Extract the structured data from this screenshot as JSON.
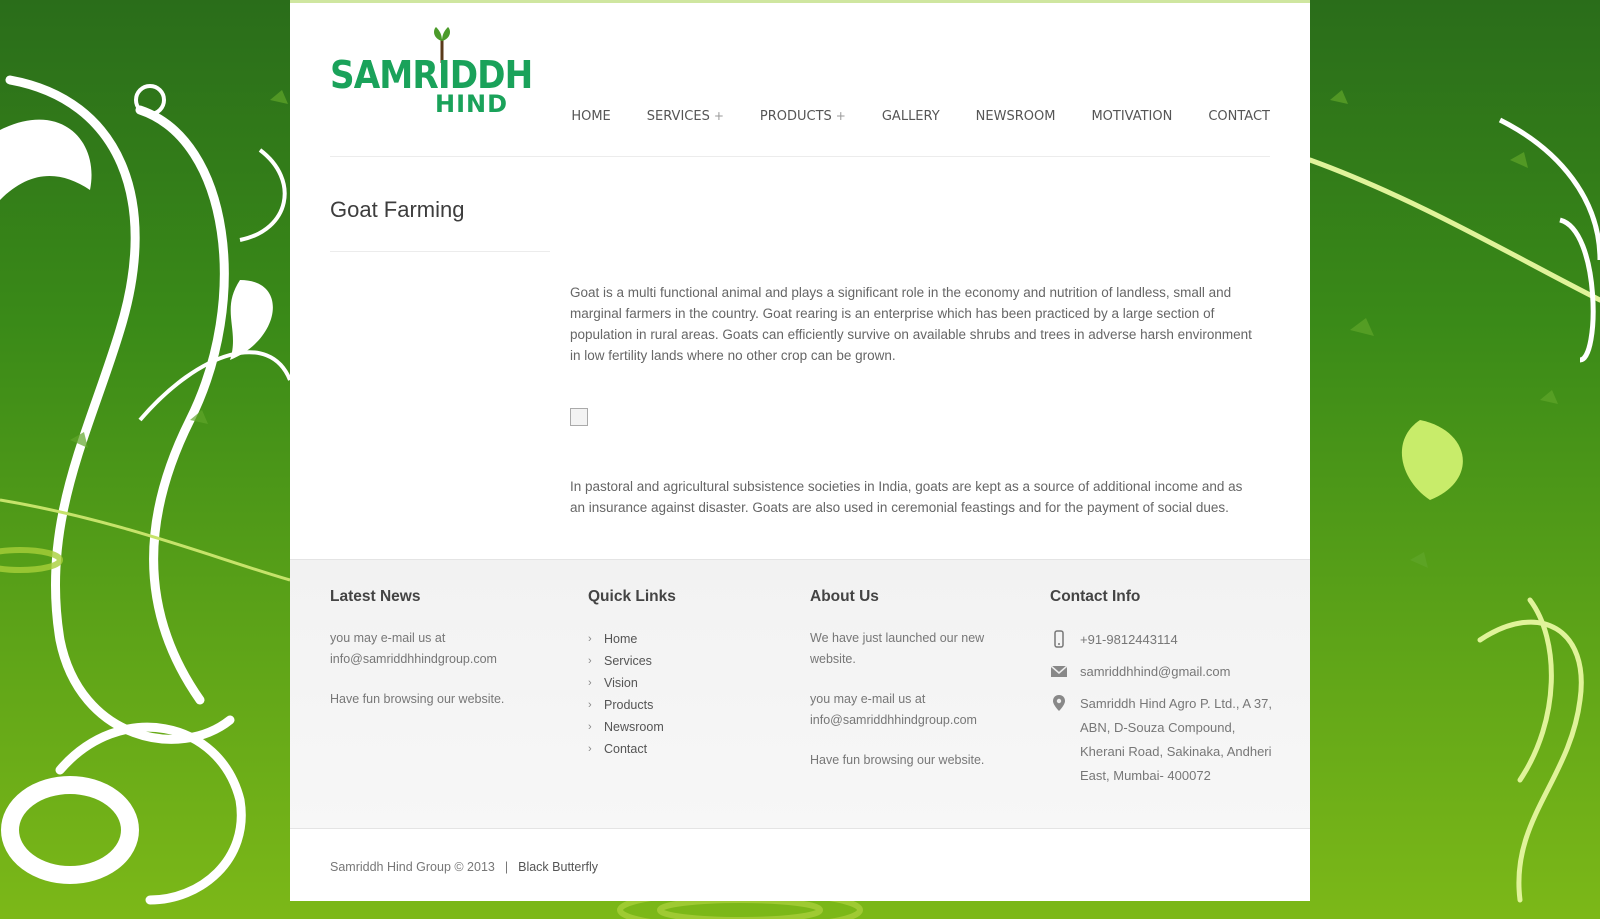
{
  "logo": {
    "line1": "SAMRIDDH",
    "line2": "HIND"
  },
  "nav": {
    "items": [
      {
        "label": "HOME",
        "has_sub": false
      },
      {
        "label": "SERVICES",
        "has_sub": true
      },
      {
        "label": "PRODUCTS",
        "has_sub": true
      },
      {
        "label": "GALLERY",
        "has_sub": false
      },
      {
        "label": "NEWSROOM",
        "has_sub": false
      },
      {
        "label": "MOTIVATION",
        "has_sub": false
      },
      {
        "label": "CONTACT",
        "has_sub": false
      }
    ],
    "sub_marker": "+"
  },
  "page": {
    "title": "Goat Farming",
    "para1": "Goat is a multi functional animal and plays a significant role in the economy and nutrition of landless, small and marginal farmers in the country. Goat rearing is an enterprise which has been practiced by a large section of population in rural areas. Goats can efficiently survive on available shrubs and trees in adverse harsh environment in low fertility lands where no other crop can be grown.",
    "para2": "In pastoral and agricultural subsistence societies in India, goats are kept as a source of additional income and as an insurance against disaster. Goats are also used in ceremonial feastings and for the payment of social dues."
  },
  "footer": {
    "latest_news": {
      "heading": "Latest News",
      "line1": "you may e-mail us at",
      "line2": "info@samriddhhindgroup.com",
      "line3": "Have fun browsing our website."
    },
    "quick_links": {
      "heading": "Quick Links",
      "items": [
        "Home",
        "Services",
        "Vision",
        "Products",
        "Newsroom",
        "Contact"
      ]
    },
    "about": {
      "heading": "About Us",
      "line1": "We have just launched our new website.",
      "line2": "you may e-mail us at info@samriddhhindgroup.com",
      "line3": "Have fun browsing our website."
    },
    "contact": {
      "heading": "Contact Info",
      "phone": "+91-9812443114",
      "email": "samriddhhind@gmail.com",
      "address": "Samriddh Hind Agro P. Ltd., A 37, ABN, D-Souza Compound, Kherani Road, Sakinaka, Andheri East, Mumbai- 400072"
    }
  },
  "bottom": {
    "copyright": "Samriddh Hind Group © 2013",
    "separator": "|",
    "credit": "Black Butterfly"
  },
  "colors": {
    "brand_green": "#1aa25a",
    "leaf_green": "#4b9b2a",
    "bg_dark": "#2a6d1a",
    "bg_light": "#7cb818"
  }
}
